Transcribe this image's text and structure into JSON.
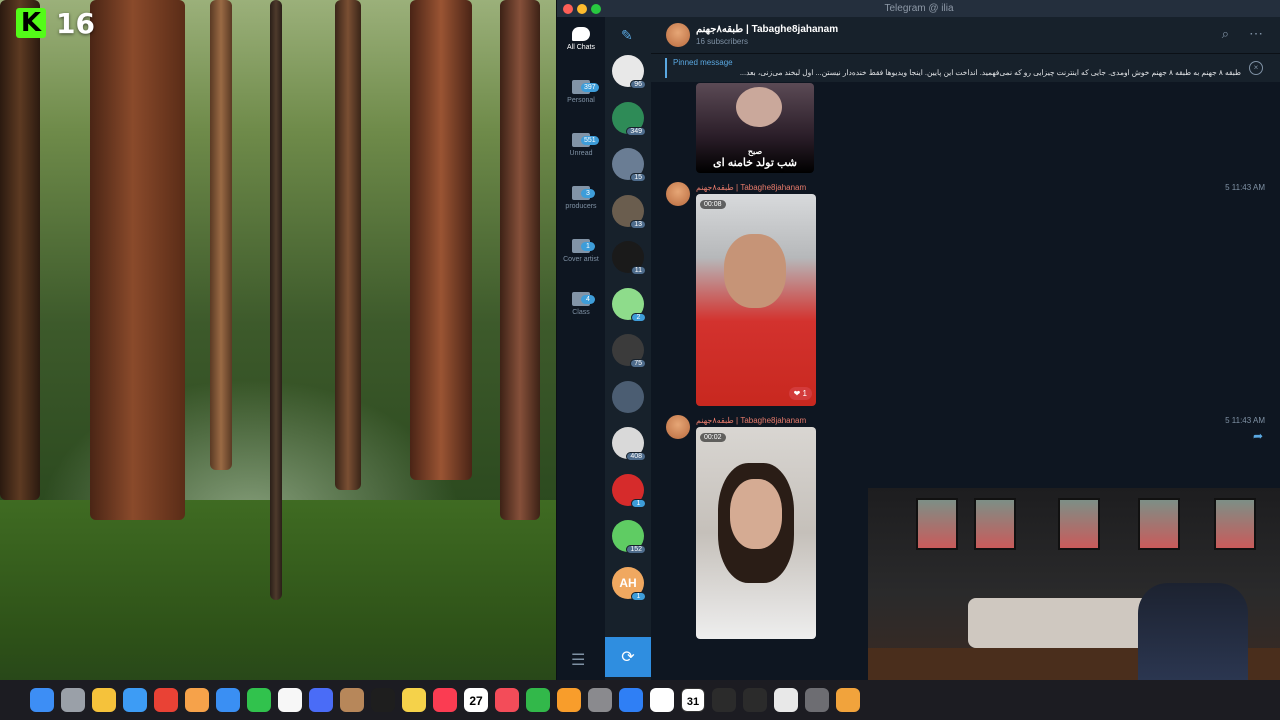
{
  "overlay": {
    "brand_letter": "K",
    "brand_number": "16"
  },
  "window": {
    "title": "Telegram @ ilia"
  },
  "folders": [
    {
      "label": "All Chats",
      "badge": ""
    },
    {
      "label": "Personal",
      "badge": "397"
    },
    {
      "label": "Unread",
      "badge": "551"
    },
    {
      "label": "producers",
      "badge": "3"
    },
    {
      "label": "Cover artist",
      "badge": "1"
    },
    {
      "label": "Class",
      "badge": "4"
    }
  ],
  "chats": [
    {
      "badge": "96",
      "color": "#e8e8e8"
    },
    {
      "badge": "349",
      "color": "#2e8b57"
    },
    {
      "badge": "15",
      "color": "#6a7d94"
    },
    {
      "badge": "13",
      "color": "#6a5d4e"
    },
    {
      "badge": "11",
      "color": "#1a1a1a"
    },
    {
      "badge": "2",
      "color": "#8edc8b"
    },
    {
      "badge": "75",
      "color": "#3b3b3b"
    },
    {
      "badge": "",
      "color": "#4b5d72"
    },
    {
      "badge": "408",
      "color": "#d9d9d9"
    },
    {
      "badge": "1",
      "color": "#d62b2b"
    },
    {
      "badge": "152",
      "color": "#5fcc63"
    },
    {
      "badge": "1",
      "color": "#f0a860",
      "initials": "AH"
    }
  ],
  "channel": {
    "name": "طبقه۸جهنم | Tabaghe8jahanam",
    "subscribers": "16 subscribers"
  },
  "pinned": {
    "title": "Pinned message",
    "text": "طبقه ۸ جهنم به طبقه ۸ جهنم خوش اومدی. جایی که اینترنت چیزایی رو که نمی‌فهمید. انداخت این پایین. اینجا ویدیوها فقط خنده‌دار نیستن... اول لبخند می‌زنی، بعد..."
  },
  "messages": [
    {
      "image_caption": "شب تولد خامنه ای",
      "image_subcaption": "صبح"
    },
    {
      "sender": "طبقه۸جهنم | Tabaghe8jahanam",
      "views": "5 11:43 AM",
      "duration": "00:08",
      "reaction": "1"
    },
    {
      "sender": "طبقه۸جهنم | Tabaghe8jahanam",
      "views": "5 11:43 AM",
      "duration": "00:02"
    }
  ],
  "dock": {
    "apps": [
      "finder",
      "launchpad",
      "quicksilver",
      "safari",
      "chrome",
      "photos",
      "mail",
      "facetime",
      "notes-badge",
      "freeform",
      "archive",
      "appletv",
      "notes",
      "music",
      "calendar",
      "news",
      "numbers",
      "pages",
      "system-settings",
      "app-store",
      "notion",
      "calendar-31",
      "logic",
      "logic2",
      "unity",
      "disk",
      "garageband"
    ],
    "calendar_day": "27",
    "calendar_alt": "31"
  }
}
